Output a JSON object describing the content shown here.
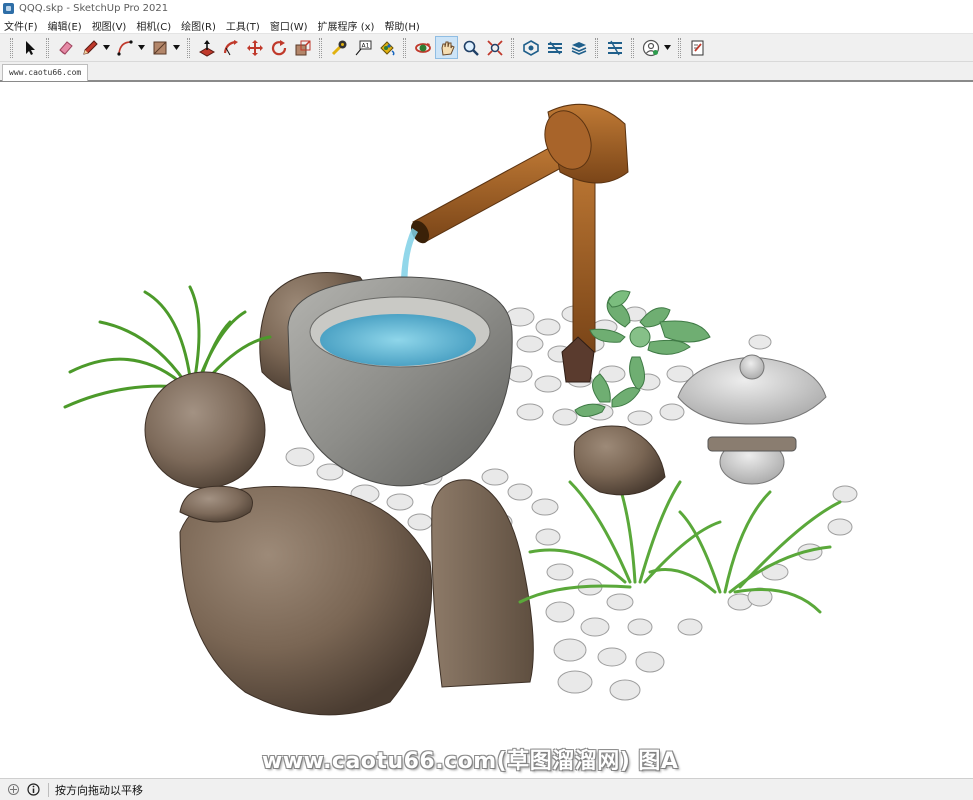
{
  "window": {
    "title": "QQQ.skp - SketchUp Pro 2021"
  },
  "menu": [
    "文件(F)",
    "编辑(E)",
    "视图(V)",
    "相机(C)",
    "绘图(R)",
    "工具(T)",
    "窗口(W)",
    "扩展程序 (x)",
    "帮助(H)"
  ],
  "scene_tab": {
    "label": "www.caotu66.com"
  },
  "toolbar": {
    "active_tool": "pan",
    "tools": [
      "select",
      "eraser",
      "line",
      "arc",
      "shape",
      "push-pull",
      "move",
      "rotate",
      "scale",
      "offset",
      "tape-measure",
      "text",
      "paint-bucket",
      "orbit",
      "pan",
      "zoom",
      "zoom-extents",
      "3d-warehouse",
      "extension-warehouse",
      "layout",
      "send-to-layout",
      "account",
      "style"
    ]
  },
  "viewport": {
    "watermark": "www.caotu66.com(草图溜溜网) 图A",
    "model": "竹筒流水 石钵 景观小品"
  },
  "status": {
    "text": "按方向拖动以平移"
  },
  "colors": {
    "accent": "#2e6ea7",
    "selection": "#cde4f7",
    "water": "#5ab4d4",
    "bamboo": "#9a5a23",
    "grass": "#5aa83a"
  }
}
